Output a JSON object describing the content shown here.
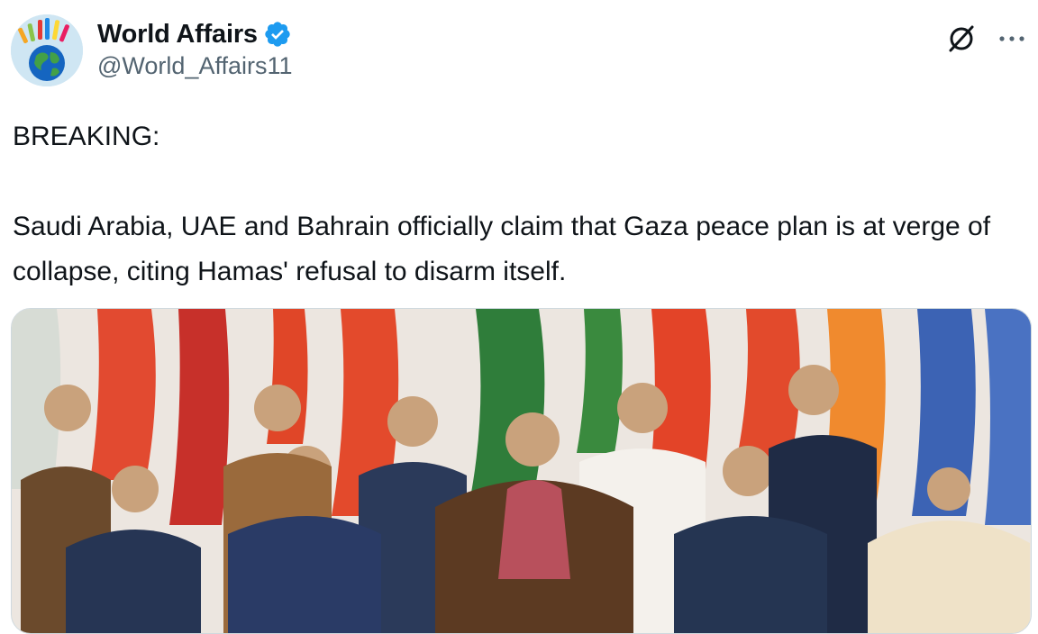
{
  "tweet": {
    "author": {
      "display_name": "World Affairs",
      "handle": "@World_Affairs11",
      "verified": true,
      "avatar_icon": "globe-hands-icon"
    },
    "headline": "BREAKING:",
    "body": "Saudi Arabia, UAE and Bahrain officially claim that Gaza peace plan is at verge of collapse, citing Hamas' refusal to disarm itself.",
    "media": {
      "kind": "photo",
      "alt": ""
    },
    "actions": {
      "grok_icon": "grok-icon",
      "more_icon": "more-horizontal-icon"
    }
  },
  "colors": {
    "verified_badge": "#1d9bf0",
    "handle_text": "#536471",
    "border": "#cfd9de",
    "text": "#0f1419"
  }
}
